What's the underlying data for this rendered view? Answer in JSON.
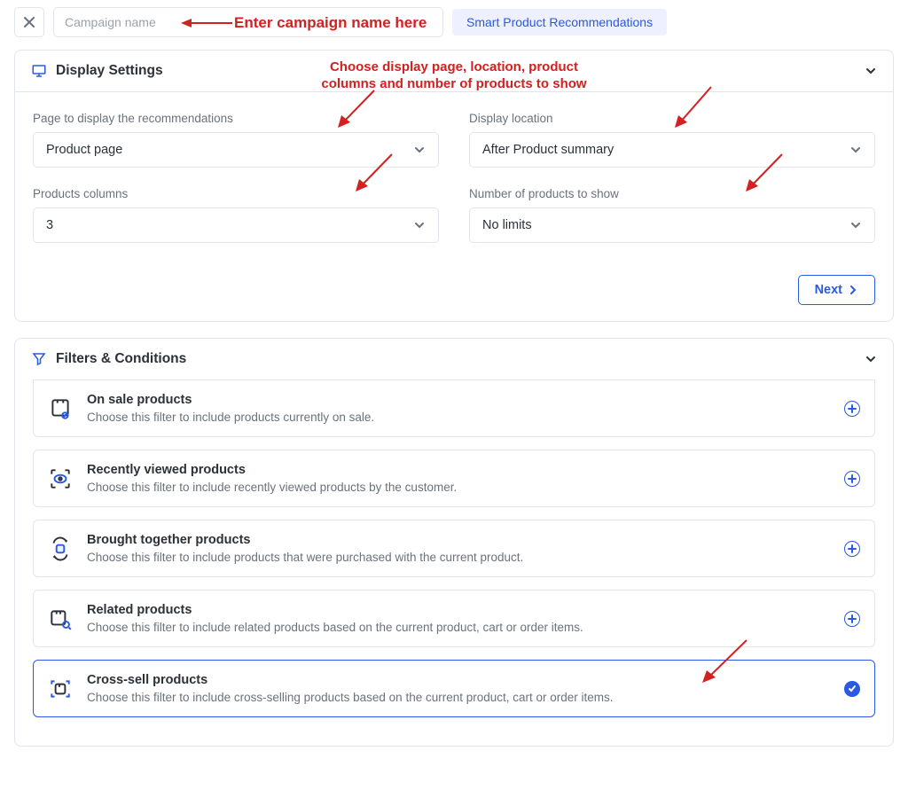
{
  "header": {
    "name_placeholder": "Campaign name",
    "badge": "Smart Product Recommendations"
  },
  "annotations": {
    "name_help": "Enter campaign name here",
    "display_help": "Choose display page, location, product\ncolumns and number of products to show"
  },
  "display": {
    "title": "Display Settings",
    "page_label": "Page to display the recommendations",
    "page_value": "Product page",
    "loc_label": "Display location",
    "loc_value": "After Product summary",
    "cols_label": "Products columns",
    "cols_value": "3",
    "num_label": "Number of products to show",
    "num_value": "No limits",
    "next": "Next"
  },
  "filters": {
    "title": "Filters & Conditions",
    "items": [
      {
        "title": "On sale products",
        "desc": "Choose this filter to include products currently on sale."
      },
      {
        "title": "Recently viewed products",
        "desc": "Choose this filter to include recently viewed products by the customer."
      },
      {
        "title": "Brought together products",
        "desc": "Choose this filter to include products that were purchased with the current product."
      },
      {
        "title": "Related products",
        "desc": "Choose this filter to include related products based on the current product, cart or order items."
      },
      {
        "title": "Cross-sell products",
        "desc": "Choose this filter to include cross-selling products based on the current product, cart or order items."
      }
    ]
  }
}
